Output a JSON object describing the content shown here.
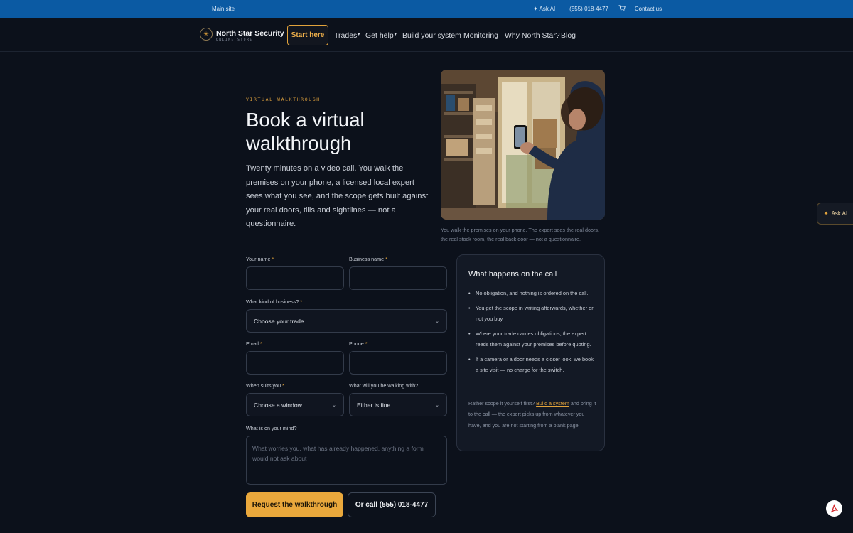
{
  "topbar": {
    "main_site": "Main site",
    "ask_ai": "✦ Ask AI",
    "phone": "(555) 018-4477",
    "contact": "Contact us"
  },
  "nav": {
    "brand_name": "North Star Security",
    "brand_sub": "ONLINE STORE",
    "start_here": "Start here",
    "items": {
      "trades": "Trades",
      "get_help": "Get help",
      "build": "Build your system",
      "monitoring": "Monitoring",
      "why": "Why North Star?",
      "blog": "Blog"
    }
  },
  "hero": {
    "eyebrow": "VIRTUAL WALKTHROUGH",
    "title": "Book a virtual walkthrough",
    "text": "Twenty minutes on a video call. You walk the premises on your phone, a licensed local expert sees what you see, and the scope gets built against your real doors, tills and sightlines — not a questionnaire.",
    "photo_caption": "You walk the premises on your phone. The expert sees the real doors, the real stock room, the real back door — not a questionnaire."
  },
  "form": {
    "your_name": "Your name",
    "business_name": "Business name",
    "business_kind": "What kind of business?",
    "trade_select": "Choose your trade",
    "email": "Email",
    "phone": "Phone",
    "when": "When suits you",
    "window_select": "Choose a window",
    "walking_with": "What will you be walking with?",
    "walking_select": "Either is fine",
    "mind": "What is on your mind?",
    "mind_placeholder": "What worries you, what has already happened, anything a form would not ask about",
    "required_mark": "*",
    "submit": "Request the walkthrough",
    "call": "Or call (555) 018-4477"
  },
  "card": {
    "title": "What happens on the call",
    "items": [
      "No obligation, and nothing is ordered on the call.",
      "You get the scope in writing afterwards, whether or not you buy.",
      "Where your trade carries obligations, the expert reads them against your premises before quoting.",
      "If a camera or a door needs a closer look, we book a site visit — no charge for the switch."
    ],
    "foot_pre": "Rather scope it yourself first? ",
    "foot_link": "Build a system",
    "foot_post": " and bring it to the call — the expert picks up from whatever you have, and you are not starting from a blank page."
  },
  "floating": {
    "ask_ai": "Ask AI"
  },
  "colors": {
    "accent": "#e2a33b",
    "topbar": "#0b5aa3",
    "background": "#0c111b"
  }
}
